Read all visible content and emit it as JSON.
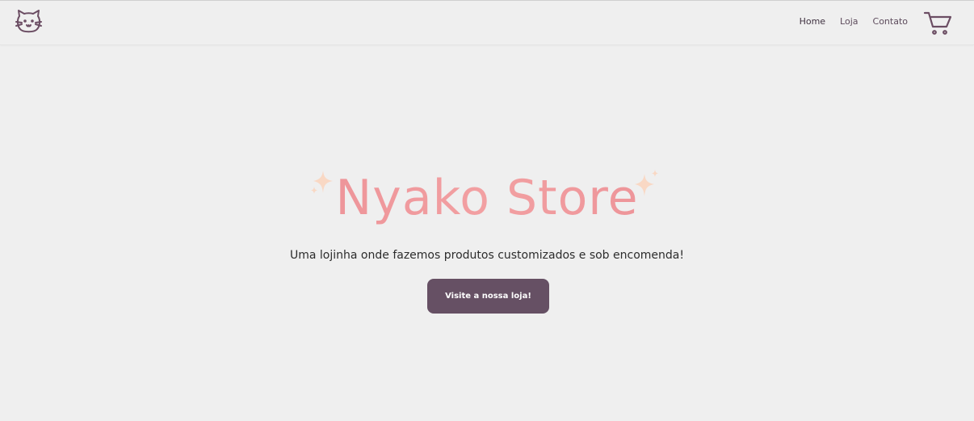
{
  "header": {
    "logo_icon": "cat-face-icon",
    "nav": [
      {
        "label": "Home",
        "active": true
      },
      {
        "label": "Loja",
        "active": false
      },
      {
        "label": "Contato",
        "active": false
      }
    ],
    "cart_icon": "shopping-cart-icon"
  },
  "hero": {
    "title": "Nyako Store",
    "subtitle": "Uma lojinha onde fazemos produtos customizados e sob encomenda!",
    "cta_label": "Visite a nossa loja!",
    "sparkle_icon": "sparkle-icon"
  },
  "colors": {
    "background": "#efefef",
    "accent": "#665064",
    "title": "#e98891",
    "sparkle": "#f8d9c8",
    "nav_text": "#5d4b5c"
  }
}
